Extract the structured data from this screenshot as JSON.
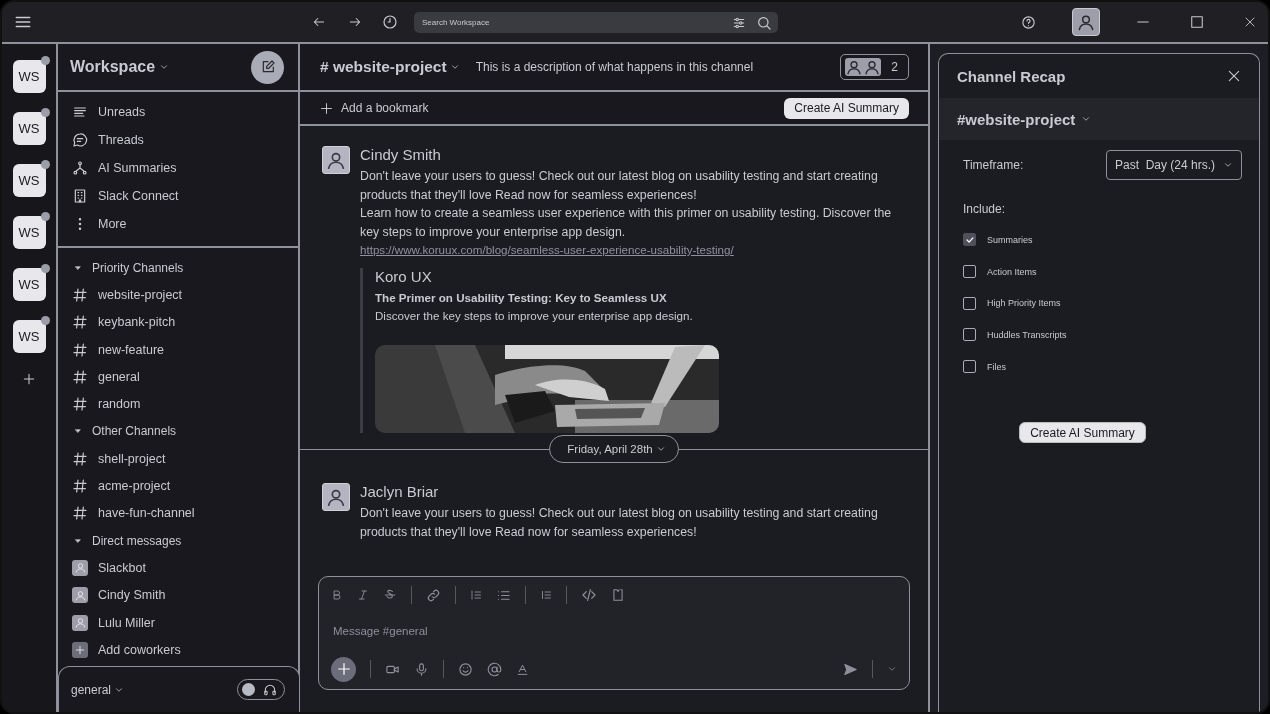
{
  "titlebar": {
    "search": {
      "placeholder": "Search Workspace"
    }
  },
  "workspaces": [
    {
      "label": "WS",
      "unread": true
    },
    {
      "label": "WS",
      "unread": true
    },
    {
      "label": "WS",
      "unread": true
    },
    {
      "label": "WS",
      "unread": true
    },
    {
      "label": "WS",
      "unread": true
    },
    {
      "label": "WS",
      "unread": true
    }
  ],
  "sidebar": {
    "title": "Workspace",
    "nav": [
      {
        "label": "Unreads"
      },
      {
        "label": "Threads"
      },
      {
        "label": "AI Summaries"
      },
      {
        "label": "Slack Connect"
      },
      {
        "label": "More"
      }
    ],
    "sections": [
      {
        "title": "Priority Channels",
        "expanded": true,
        "items": [
          {
            "kind": "channel",
            "label": "website-project"
          },
          {
            "kind": "channel",
            "label": "keybank-pitch"
          },
          {
            "kind": "channel",
            "label": "new-feature"
          },
          {
            "kind": "channel",
            "label": "general"
          },
          {
            "kind": "channel",
            "label": "random"
          }
        ]
      },
      {
        "title": "Other Channels",
        "expanded": true,
        "items": [
          {
            "kind": "channel",
            "label": "shell-project"
          },
          {
            "kind": "channel",
            "label": "acme-project"
          },
          {
            "kind": "channel",
            "label": "have-fun-channel"
          }
        ]
      },
      {
        "title": "Direct messages",
        "expanded": true,
        "items": [
          {
            "kind": "dm",
            "label": "Slackbot"
          },
          {
            "kind": "dm",
            "label": "Cindy Smith"
          },
          {
            "kind": "dm",
            "label": "Lulu Miller"
          },
          {
            "kind": "add",
            "label": "Add coworkers"
          }
        ]
      }
    ],
    "footer": {
      "channel": "general",
      "on": false
    }
  },
  "channel": {
    "name": "# website-project",
    "description": "This is a description of what happens in this channel",
    "member_count": "2",
    "bookmark": "Add a bookmark",
    "summary_button": "Create AI Summary"
  },
  "messages": [
    {
      "author": "Cindy Smith",
      "paragraphs": [
        "Don't leave your users to guess! Check out our latest blog on usability testing and start creating products that they'll love Read now for seamless experiences!",
        "Learn how to create a seamless user experience with this primer on usability testing. Discover the key steps to improve your enterprise app design."
      ],
      "link": "https://www.koruux.com/blog/seamless-user-experience-usability-testing/",
      "preview": {
        "site": "Koro UX",
        "title": "The Primer on Usability Testing: Key to Seamless UX",
        "description": "Discover the key steps to improve your enterprise app design."
      }
    },
    {
      "author": "Jaclyn Briar",
      "paragraphs": [
        "Don't leave your users to guess! Check out our latest blog on usability testing and start creating products that they'll love Read now for seamless experiences!"
      ]
    }
  ],
  "date_divider": "Friday, April 28th",
  "composer": {
    "placeholder": "Message #general"
  },
  "recap": {
    "title": "Channel Recap",
    "channel": "#website-project",
    "timeframe_label": "Timeframe:",
    "timeframe": "Past  Day (24 hrs.)",
    "include_label": "Include:",
    "options": [
      {
        "label": "Summaries",
        "checked": true
      },
      {
        "label": "Action Items",
        "checked": false
      },
      {
        "label": "High Priority Items",
        "checked": false
      },
      {
        "label": "Huddles Transcripts",
        "checked": false
      },
      {
        "label": "Files",
        "checked": false
      }
    ],
    "button": "Create AI Summary"
  }
}
